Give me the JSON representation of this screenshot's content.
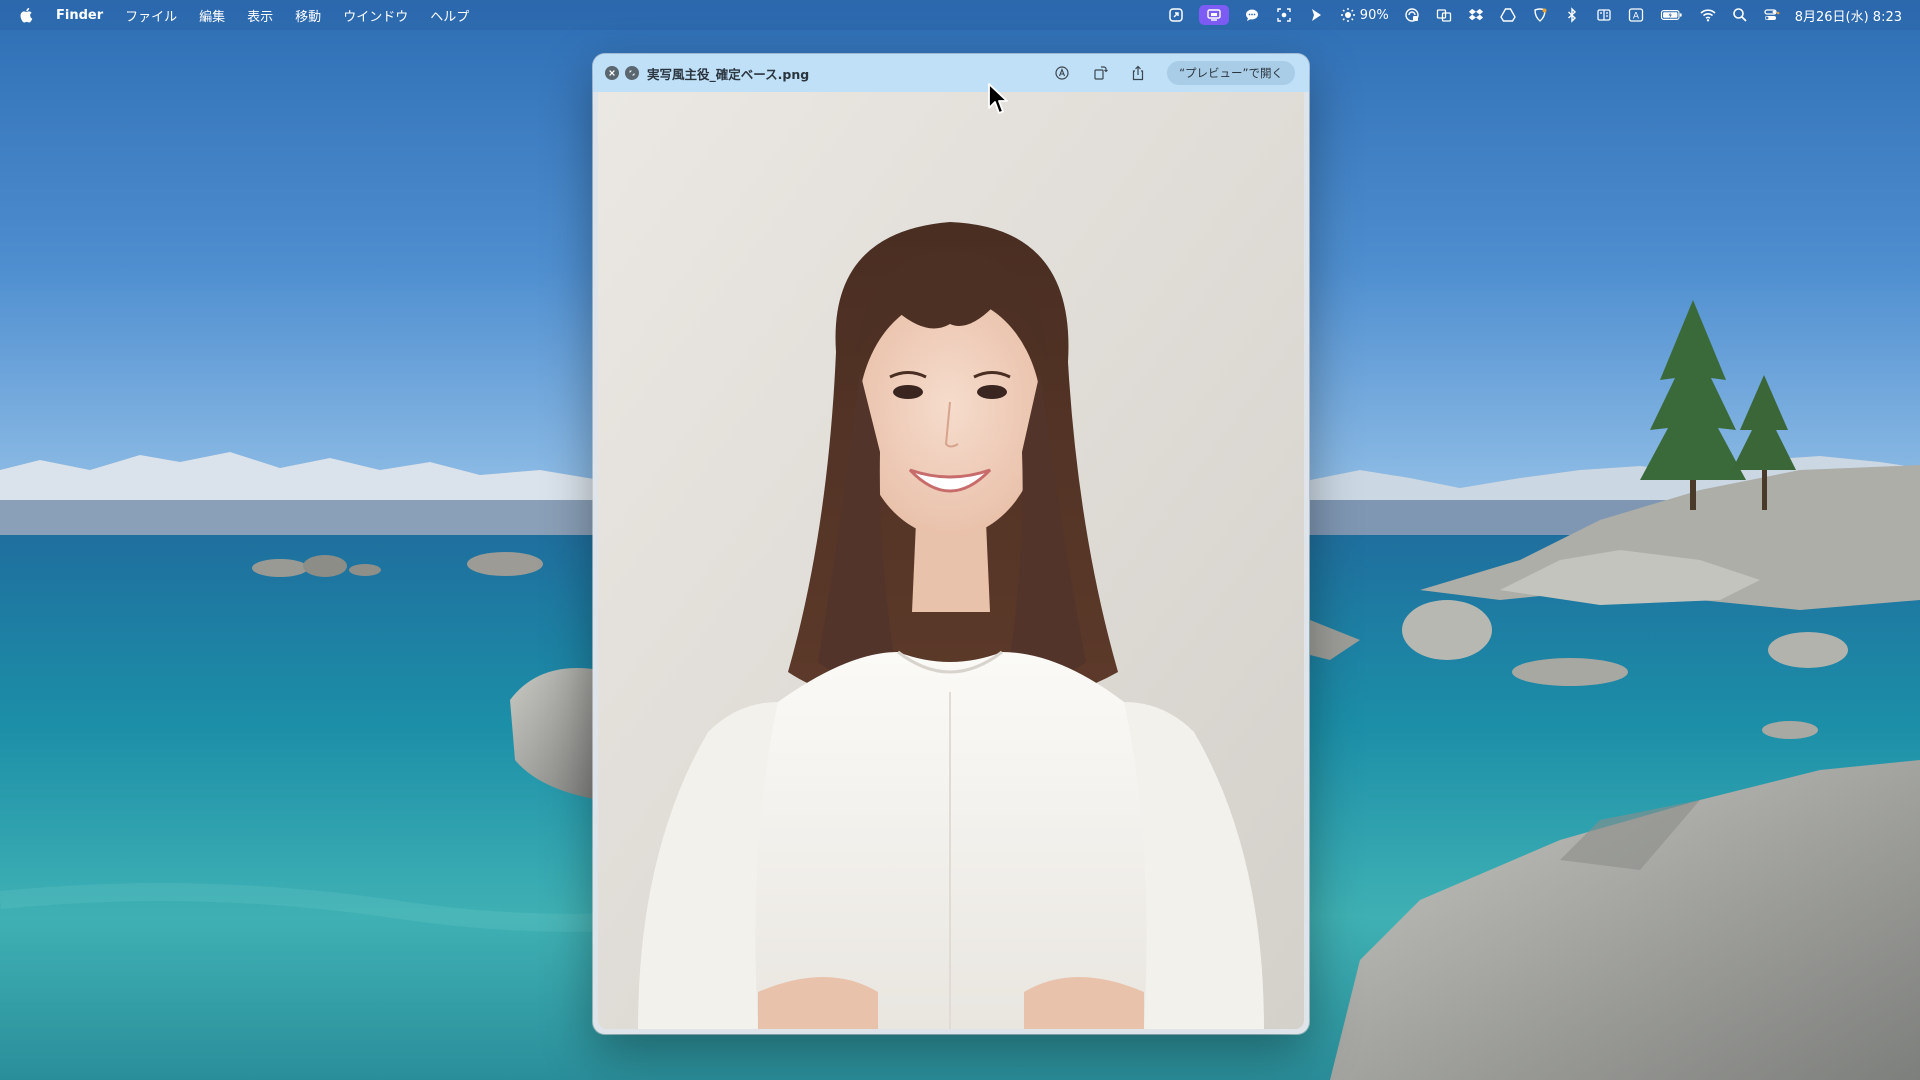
{
  "menubar": {
    "app_name": "Finder",
    "menus": [
      "ファイル",
      "編集",
      "表示",
      "移動",
      "ウインドウ",
      "ヘルプ"
    ],
    "status_icons": [
      "shortcut-icon",
      "screen-mirroring-icon",
      "chat-icon",
      "screenshot-icon",
      "direction-icon",
      "brightness-icon",
      "vpn-icon",
      "translate-icon",
      "dropbox-icon",
      "google-drive-icon",
      "shield-icon",
      "bluetooth-icon",
      "split-view-icon",
      "input-source-icon",
      "battery-icon",
      "wifi-icon",
      "spotlight-icon",
      "control-center-icon"
    ],
    "brightness_level": "90%",
    "input_source": "A",
    "datetime": "8月26日(水) 8:23"
  },
  "quicklook": {
    "filename": "実写風主役_確定ベース.png",
    "open_with_label": "“プレビュー”で開く",
    "tool_icons": [
      "markup-icon",
      "rotate-icon",
      "share-icon"
    ]
  },
  "colors": {
    "menubar_active": "#7c5cf5",
    "titlebar": "#bfe0f6",
    "button": "#a9cde6"
  }
}
